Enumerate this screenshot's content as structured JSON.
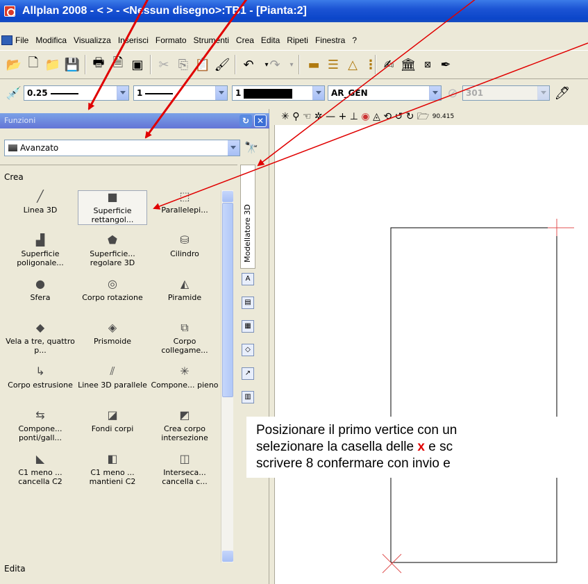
{
  "window": {
    "title": "Allplan 2008 - <        > - <Nessun disegno>:TB1 - [Pianta:2]"
  },
  "menu": [
    "File",
    "Modifica",
    "Visualizza",
    "Inserisci",
    "Formato",
    "Strumenti",
    "Crea",
    "Edita",
    "Ripeti",
    "Finestra",
    "?"
  ],
  "format_bar": {
    "pen_value": "0.25",
    "line_value": "1",
    "color_value": "1",
    "layer_value": "AR_GEN",
    "pattern_value": "301"
  },
  "panel": {
    "title": "Funzioni",
    "mode": "Avanzato",
    "vertical_tab": "Modellatore 3D",
    "section_crea": "Crea",
    "section_edita": "Edita",
    "tools": [
      {
        "label": "Linea 3D",
        "icon": "line-3d-icon"
      },
      {
        "label": "Superficie rettangol...",
        "icon": "rect-surface-icon"
      },
      {
        "label": "Parallelepi...",
        "icon": "box-icon"
      },
      {
        "label": "Superficie poligonale...",
        "icon": "polygon-surface-icon"
      },
      {
        "label": "Superficie... regolare 3D",
        "icon": "regular-surface-icon"
      },
      {
        "label": "Cilindro",
        "icon": "cylinder-icon"
      },
      {
        "label": "Sfera",
        "icon": "sphere-icon"
      },
      {
        "label": "Corpo rotazione",
        "icon": "rotation-body-icon"
      },
      {
        "label": "Piramide",
        "icon": "pyramid-icon"
      },
      {
        "label": "Vela a tre, quattro p...",
        "icon": "sail-icon"
      },
      {
        "label": "Prismoide",
        "icon": "prismoid-icon"
      },
      {
        "label": "Corpo collegame...",
        "icon": "connection-body-icon"
      },
      {
        "label": "Corpo estrusione",
        "icon": "extrusion-icon"
      },
      {
        "label": "Linee 3D parallele",
        "icon": "parallel-lines-icon"
      },
      {
        "label": "Compone... pieno",
        "icon": "solid-component-icon"
      },
      {
        "label": "Compone... ponti/gall...",
        "icon": "bridge-component-icon"
      },
      {
        "label": "Fondi corpi",
        "icon": "merge-bodies-icon"
      },
      {
        "label": "Crea corpo intersezione",
        "icon": "intersection-body-icon"
      },
      {
        "label": "C1 meno ... cancella C2",
        "icon": "subtract-delete-icon"
      },
      {
        "label": "C1 meno ... mantieni C2",
        "icon": "subtract-keep-icon"
      },
      {
        "label": "Interseca... cancella c...",
        "icon": "intersect-delete-icon"
      }
    ]
  },
  "draw_toolbar": {
    "value": "90.415"
  },
  "callout": {
    "line1": "Posizionare il primo vertice con un",
    "line2_pre": "selezionare la casella delle ",
    "line2_x": "x",
    "line2_post": " e sc",
    "line3": "scrivere 8 confermare con invio e"
  },
  "colors": {
    "titlebar": "#0b45c9",
    "panel_header": "#6375d6",
    "arrow": "#e00000",
    "vertex_marker": "#e05050"
  }
}
